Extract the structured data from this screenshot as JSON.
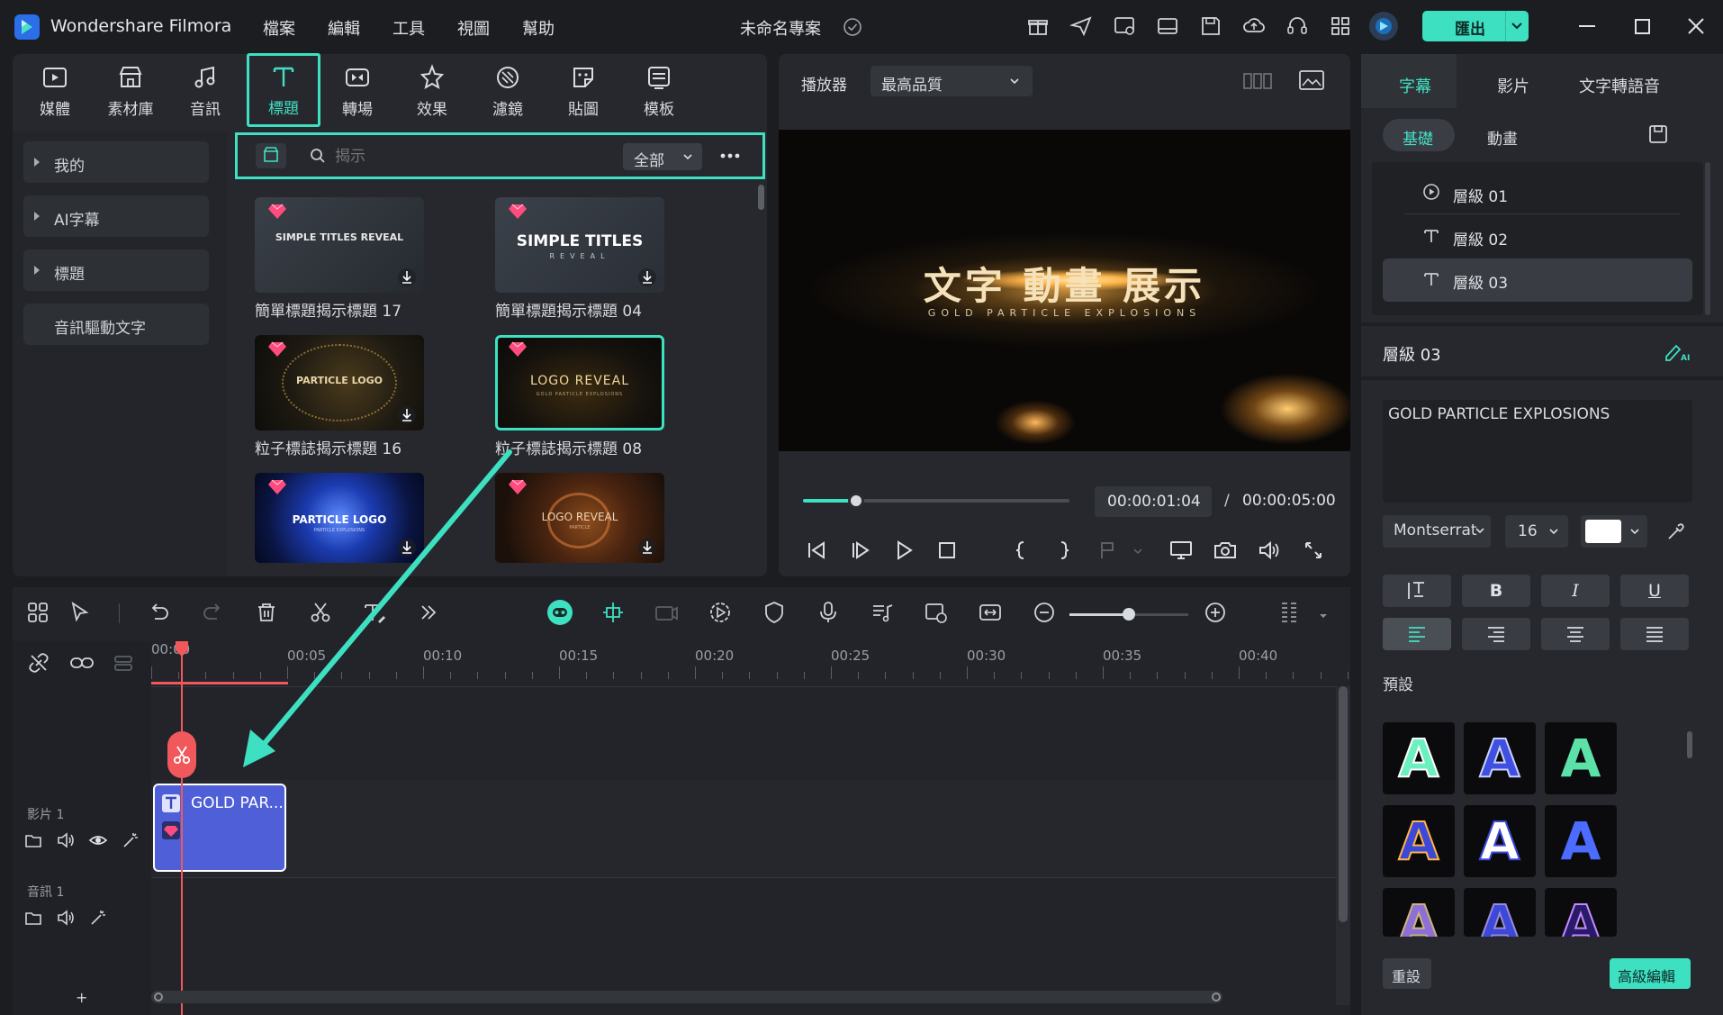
{
  "app": {
    "title": "Wondershare Filmora",
    "project_name": "未命名專案"
  },
  "menu": [
    "檔案",
    "編輯",
    "工具",
    "視圖",
    "幫助"
  ],
  "export_label": "匯出",
  "toolbar_tabs": [
    {
      "label": "媒體",
      "icon": "media-icon"
    },
    {
      "label": "素材庫",
      "icon": "stock-icon"
    },
    {
      "label": "音訊",
      "icon": "music-icon"
    },
    {
      "label": "標題",
      "icon": "title-icon",
      "active": true
    },
    {
      "label": "轉場",
      "icon": "transition-icon"
    },
    {
      "label": "效果",
      "icon": "effects-icon"
    },
    {
      "label": "濾鏡",
      "icon": "filter-icon"
    },
    {
      "label": "貼圖",
      "icon": "sticker-icon"
    },
    {
      "label": "模板",
      "icon": "template-icon"
    }
  ],
  "categories": [
    "我的",
    "AI字幕",
    "標題",
    "音訊驅動文字"
  ],
  "search": {
    "placeholder": "揭示",
    "filter": "全部"
  },
  "assets": [
    {
      "label": "簡單標題揭示標題 17",
      "thumb_text": "SIMPLE TITLES REVEAL"
    },
    {
      "label": "簡單標題揭示標題 04",
      "thumb_text": "SIMPLE TITLES",
      "thumb_sub": "REVEAL"
    },
    {
      "label": "粒子標誌揭示標題 16",
      "thumb_text": "PARTICLE LOGO"
    },
    {
      "label": "粒子標誌揭示標題 08",
      "thumb_text": "LOGO REVEAL",
      "thumb_sub": "GOLD PARTICLE EXPLOSIONS"
    },
    {
      "label": "",
      "thumb_text": "PARTICLE LOGO",
      "thumb_sub": "PARTICLE EXPLOSIONS"
    },
    {
      "label": "",
      "thumb_text": "LOGO REVEAL",
      "thumb_sub": "PARTICLE"
    }
  ],
  "player": {
    "label": "播放器",
    "quality": "最高品質",
    "preview_title": "文字 動畫 展示",
    "preview_subtitle": "GOLD PARTICLE EXPLOSIONS",
    "current_time": "00:00:01:04",
    "separator": "/",
    "total_time": "00:00:05:00",
    "progress": 0.2
  },
  "right_panel": {
    "tabs": [
      "字幕",
      "影片",
      "文字轉語音"
    ],
    "subtabs": [
      "基礎",
      "動畫"
    ],
    "layers": [
      "層級 01",
      "層級 02",
      "層級 03"
    ],
    "selected_layer": "層級 03",
    "text_value": "GOLD PARTICLE EXPLOSIONS",
    "font": "Montserrat",
    "font_size": "16",
    "text_color": "#ffffff",
    "bold": "B",
    "italic": "I",
    "underline": "U",
    "preset_label": "預設",
    "reset_label": "重設",
    "advanced_label": "高級編輯"
  },
  "timeline": {
    "ruler": [
      "00:00",
      "00:05",
      "00:10",
      "00:15",
      "00:20",
      "00:25",
      "00:30",
      "00:35",
      "00:40"
    ],
    "tracks": [
      {
        "label": "影片 1"
      },
      {
        "label": "音訊 1"
      }
    ],
    "clip_label": "GOLD PAR...",
    "add_track": "+"
  },
  "colors": {
    "accent": "#3ee0c2",
    "export_bg": "#3ee0c2",
    "playhead": "#f0585c",
    "clip": "#4e5fd8",
    "gem": "#ff4b7d"
  }
}
